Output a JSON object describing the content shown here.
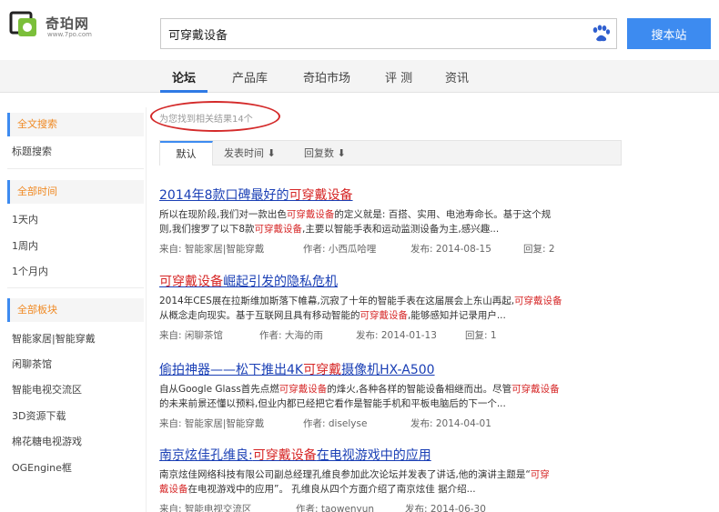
{
  "brand": {
    "name": "奇珀网",
    "url": "www.7po.com"
  },
  "search": {
    "query": "可穿戴设备",
    "button": "搜本站"
  },
  "nav": {
    "items": [
      "论坛",
      "产品库",
      "奇珀市场",
      "评 测",
      "资讯"
    ],
    "active": 0
  },
  "sidebar": {
    "groups": [
      {
        "title": "全文搜索",
        "items": [
          "标题搜索"
        ]
      },
      {
        "title": "全部时间",
        "items": [
          "1天内",
          "1周内",
          "1个月内"
        ]
      },
      {
        "title": "全部板块",
        "items": [
          "智能家居|智能穿戴",
          "闲聊茶馆",
          "智能电视交流区",
          "3D资源下载",
          "棉花糖电视游戏",
          "OGEngine框"
        ]
      }
    ]
  },
  "results_count": "为您找到相关结果14个",
  "sort": {
    "tabs": [
      "默认",
      "发表时间 ⬇",
      "回复数 ⬇"
    ]
  },
  "results": [
    {
      "title_pre": "2014年8款口碑最好的",
      "title_hl": "可穿戴设备",
      "title_post": "",
      "line1_a": "所以在现阶段,我们对一款出色",
      "line1_hl": "可穿戴设备",
      "line1_b": "的定义就是: 百搭、实用、电池寿命长。基于这个规",
      "line2_a": "则,我们搜罗了以下8款",
      "line2_hl": "可穿戴设备",
      "line2_b": ",主要以智能手表和运动监测设备为主,感兴趣...",
      "source": "来自: 智能家居|智能穿戴",
      "author": "作者: 小西瓜哈哩",
      "date": "发布: 2014-08-15",
      "replies": "回复: 2"
    },
    {
      "title_pre": "",
      "title_hl": "可穿戴设备",
      "title_post": "崛起引发的隐私危机",
      "line1_a": "2014年CES展在拉斯维加斯落下帷幕,沉寂了十年的智能手表在这届展会上东山再起,",
      "line1_hl": "可穿戴设备",
      "line1_b": "",
      "line2_a": "从概念走向现实。基于互联网且具有移动智能的",
      "line2_hl": "可穿戴设备",
      "line2_b": ",能够感知并记录用户...",
      "source": "来自: 闲聊茶馆",
      "author": "作者: 大海的雨",
      "date": "发布: 2014-01-13",
      "replies": "回复: 1"
    },
    {
      "title_pre": "偷拍神器——松下推出4K",
      "title_hl": "可穿戴",
      "title_post": "摄像机HX-A500",
      "line1_a": "自从Google Glass首先点燃",
      "line1_hl": "可穿戴设备",
      "line1_b": "的烽火,各种各样的智能设备相继而出。尽管",
      "line1_hl2": "可穿戴设备",
      "line2_a": "的未来前景还懂以预料,但业内都已经把它看作是智能手机和平板电脑后的下一个...",
      "line2_hl": "",
      "line2_b": "",
      "source": "来自: 智能家居|智能穿戴",
      "author": "作者: diselyse",
      "date": "发布: 2014-04-01",
      "replies": ""
    },
    {
      "title_pre": "南京炫佳孔维良:",
      "title_hl": "可穿戴设备",
      "title_post": "在电视游戏中的应用",
      "line1_a": "南京炫佳网络科技有限公司副总经理孔维良参加此次论坛并发表了讲话,他的演讲主题是“",
      "line1_hl": "可穿",
      "line1_b": "",
      "line2_a": "",
      "line2_hl": "戴设备",
      "line2_b": "在电视游戏中的应用”。 孔维良从四个方面介绍了南京炫佳  据介绍...",
      "source": "来自: 智能电视交流区",
      "author": "作者: taowenyun",
      "date": "发布: 2014-06-30",
      "replies": ""
    }
  ]
}
